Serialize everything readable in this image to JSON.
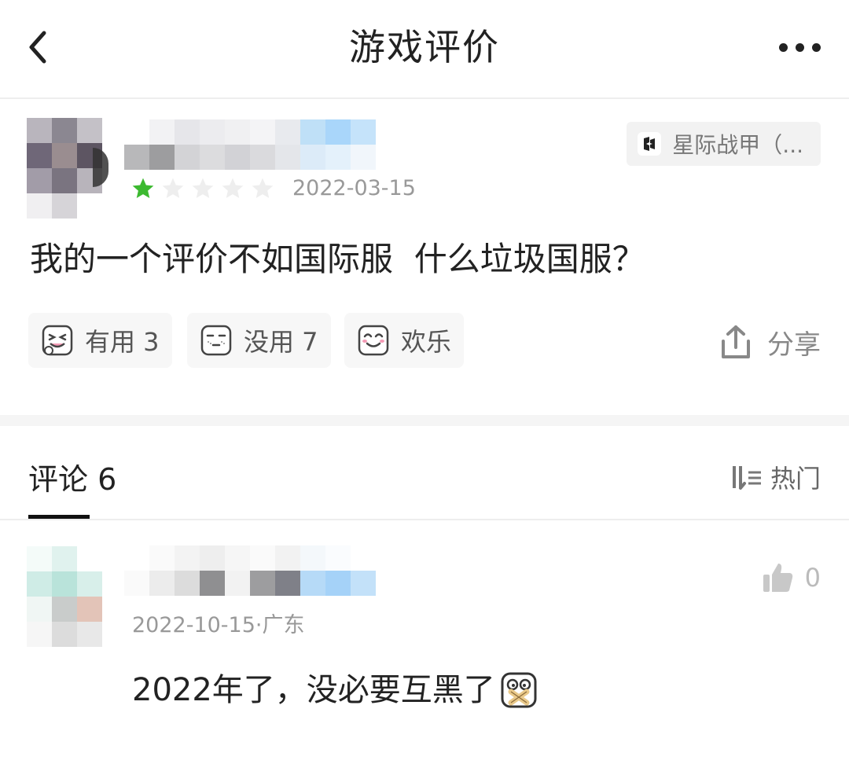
{
  "header": {
    "title": "游戏评价",
    "back_icon": "back-chevron-icon",
    "more_icon": "more-dots-icon"
  },
  "review": {
    "game_tag": "星际战甲（...",
    "rating": 1,
    "rating_max": 5,
    "date": "2022-03-15",
    "text": "我的一个评价不如国际服  什么垃圾国服？",
    "reactions": [
      {
        "label": "有用 3",
        "icon": "laugh-emoji-icon"
      },
      {
        "label": "没用 7",
        "icon": "unamused-emoji-icon"
      },
      {
        "label": "欢乐",
        "icon": "happy-emoji-icon"
      }
    ],
    "share_label": "分享"
  },
  "comments": {
    "title": "评论 6",
    "sort_label": "热门",
    "items": [
      {
        "meta": "2022-10-15·广东",
        "text": "2022年了，没必要互黑了",
        "likes": "0"
      }
    ]
  },
  "colors": {
    "star_active": "#3cb930",
    "star_inactive": "#eeeeee",
    "accent_text": "#222222",
    "muted_text": "#999999"
  }
}
